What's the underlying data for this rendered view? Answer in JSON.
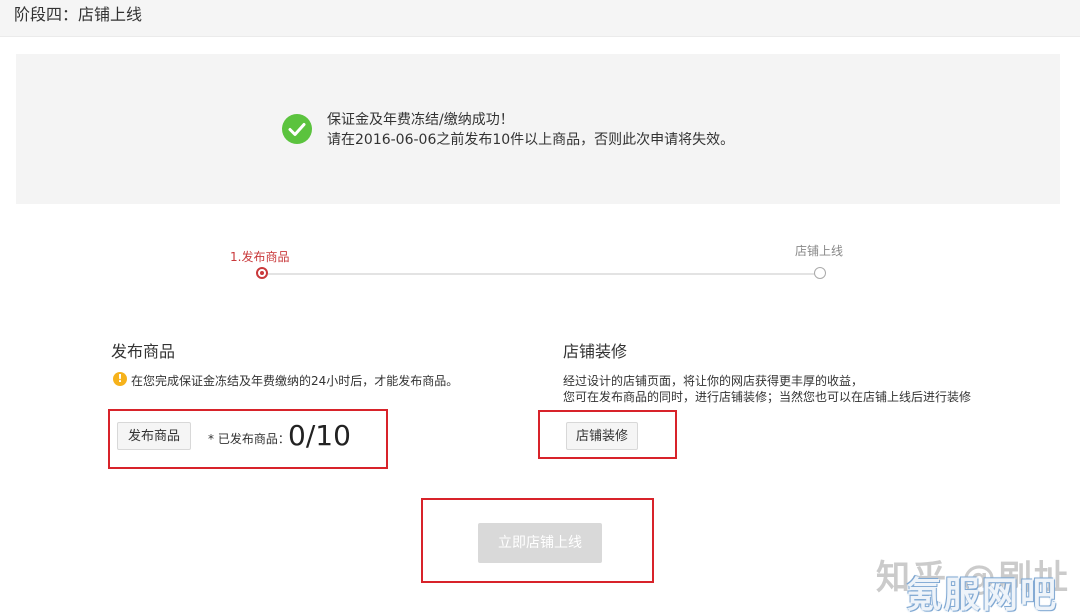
{
  "header": {
    "title": "阶段四：店铺上线"
  },
  "notice": {
    "line1": "保证金及年费冻结/缴纳成功！",
    "line2": "请在2016-06-06之前发布10件以上商品，否则此次申请将失效。",
    "icon": "check-circle-icon",
    "icon_color": "#5bc33e"
  },
  "steps": {
    "items": [
      {
        "label": "1.发布商品",
        "state": "active"
      },
      {
        "label": "店铺上线",
        "state": "pending"
      }
    ],
    "active_color": "#c9393b"
  },
  "publish_section": {
    "title": "发布商品",
    "warning": "在您完成保证金冻结及年费缴纳的24小时后，才能发布商品。",
    "warning_icon": "warning-icon",
    "button_label": "发布商品",
    "published_label": "* 已发布商品：",
    "published_count": "0/10"
  },
  "decorate_section": {
    "title": "店铺装修",
    "desc_line1": "经过设计的店铺页面，将让你的网店获得更丰厚的收益，",
    "desc_line2": "您可在发布商品的同时，进行店铺装修；当然您也可以在店铺上线后进行装修",
    "button_label": "店铺装修"
  },
  "go_live": {
    "button_label": "立即店铺上线",
    "enabled": false
  },
  "highlight_color": "#d8232a",
  "watermark": {
    "text1": "知乎 @刷址",
    "text2": "氪服网吧"
  }
}
